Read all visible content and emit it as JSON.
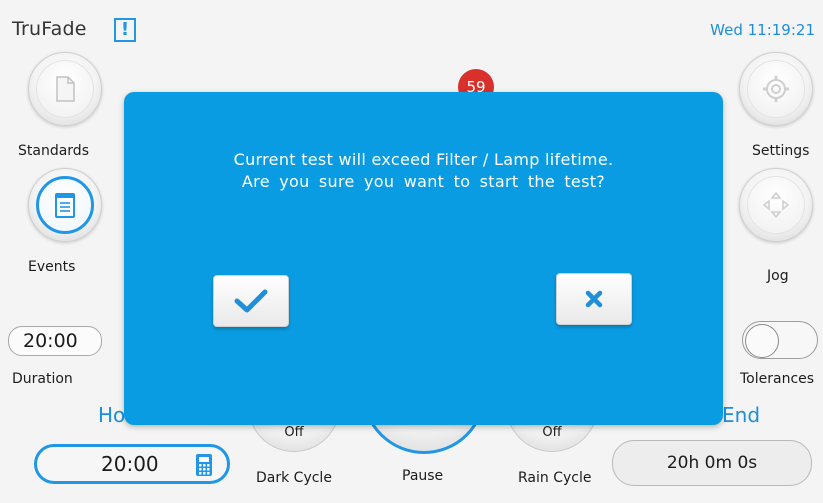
{
  "header": {
    "app_title": "TruFade",
    "alert_symbol": "!",
    "clock": "Wed 11:19:21"
  },
  "left_panel": {
    "standards_label": "Standards",
    "events_label": "Events",
    "duration_value": "20:00",
    "duration_label": "Duration"
  },
  "right_panel": {
    "settings_label": "Settings",
    "jog_label": "Jog",
    "tolerances_label": "Tolerances",
    "tolerances_on": false
  },
  "status_badge": "59",
  "bottom": {
    "left_partial_label": "Ho",
    "right_partial_label": "End",
    "time_value": "20:00",
    "dark_cycle_label": "Dark Cycle",
    "dark_cycle_state": "Off",
    "pause_label": "Pause",
    "rain_cycle_label": "Rain Cycle",
    "rain_cycle_state": "Off",
    "elapsed": "20h 0m 0s"
  },
  "dialog": {
    "line1": "Current test will exceed Filter / Lamp lifetime.",
    "line2": "Are you sure you want to start the test?",
    "confirm_icon": "check-icon",
    "cancel_icon": "x-icon"
  },
  "colors": {
    "accent": "#1f97e6",
    "dialog_bg": "#0a9ce2",
    "badge": "#d9302c"
  }
}
